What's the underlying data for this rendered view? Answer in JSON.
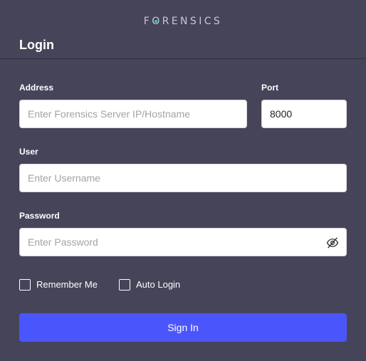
{
  "brand": {
    "text_before": "F",
    "text_o": "O",
    "text_after": "RENSICS",
    "accent_color": "#2ec4c9"
  },
  "page": {
    "title": "Login"
  },
  "form": {
    "address": {
      "label": "Address",
      "placeholder": "Enter Forensics Server IP/Hostname",
      "value": ""
    },
    "port": {
      "label": "Port",
      "placeholder": "",
      "value": "8000"
    },
    "user": {
      "label": "User",
      "placeholder": "Enter Username",
      "value": ""
    },
    "password": {
      "label": "Password",
      "placeholder": "Enter Password",
      "value": "",
      "toggle_icon": "eye-off-icon"
    },
    "remember_me": {
      "label": "Remember Me",
      "checked": false
    },
    "auto_login": {
      "label": "Auto Login",
      "checked": false
    },
    "submit_label": "Sign In"
  },
  "colors": {
    "background": "#464459",
    "primary_button": "#4a56fb",
    "text": "#ffffff"
  }
}
